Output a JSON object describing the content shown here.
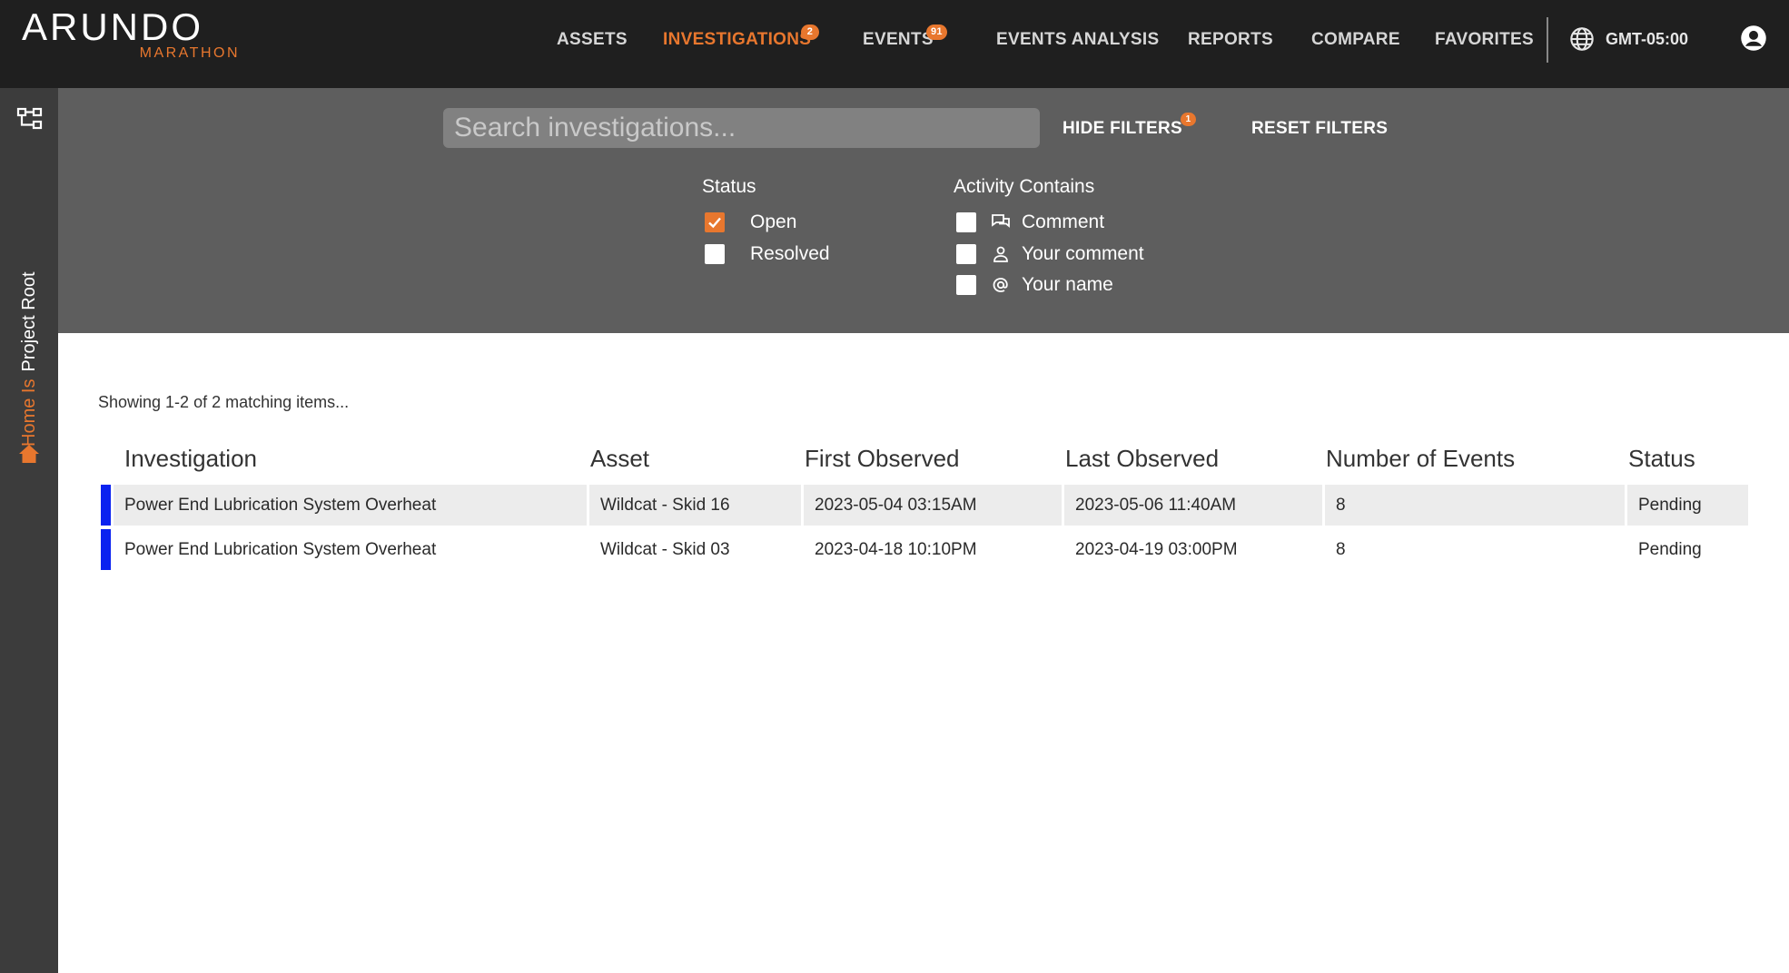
{
  "brand": {
    "name": "ARUNDO",
    "sub": "MARATHON"
  },
  "nav": {
    "items": [
      {
        "label": "ASSETS"
      },
      {
        "label": "INVESTIGATIONS",
        "badge": "2"
      },
      {
        "label": "EVENTS",
        "badge": "91"
      },
      {
        "label": "EVENTS ANALYSIS"
      },
      {
        "label": "REPORTS"
      },
      {
        "label": "COMPARE"
      },
      {
        "label": "FAVORITES"
      }
    ],
    "active": "INVESTIGATIONS",
    "timezone": "GMT-05:00"
  },
  "rail": {
    "home_prefix": "Home Is",
    "home_target": "Project Root"
  },
  "filters": {
    "search_placeholder": "Search investigations...",
    "hide_filters_label": "HIDE FILTERS",
    "hide_filters_badge": "1",
    "reset_filters_label": "RESET FILTERS",
    "status": {
      "title": "Status",
      "options": [
        {
          "label": "Open",
          "checked": true
        },
        {
          "label": "Resolved",
          "checked": false
        }
      ]
    },
    "activity": {
      "title": "Activity Contains",
      "options": [
        {
          "label": "Comment",
          "icon": "comments-icon",
          "checked": false
        },
        {
          "label": "Your comment",
          "icon": "person-icon",
          "checked": false
        },
        {
          "label": "Your name",
          "icon": "at-sign-icon",
          "checked": false
        }
      ]
    }
  },
  "results": {
    "summary": "Showing 1-2 of 2 matching items...",
    "columns": [
      "Investigation",
      "Asset",
      "First Observed",
      "Last Observed",
      "Number of Events",
      "Status"
    ],
    "rows": [
      {
        "investigation": "Power End Lubrication System Overheat",
        "asset": "Wildcat - Skid 16",
        "first_observed": "2023-05-04 03:15AM",
        "last_observed": "2023-05-06 11:40AM",
        "events": "8",
        "status": "Pending"
      },
      {
        "investigation": "Power End Lubrication System Overheat",
        "asset": "Wildcat - Skid 03",
        "first_observed": "2023-04-18 10:10PM",
        "last_observed": "2023-04-19 03:00PM",
        "events": "8",
        "status": "Pending"
      }
    ],
    "row_marker_color": "#0a22f0"
  },
  "colors": {
    "accent": "#e8772e",
    "topbar": "#1f1f1f",
    "filters_bg": "#5e5e5e",
    "rail_bg": "#3c3c3c"
  }
}
